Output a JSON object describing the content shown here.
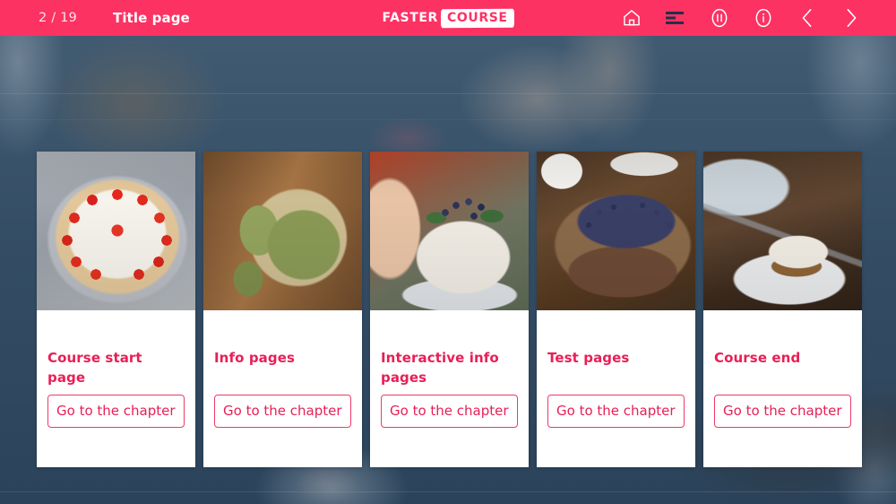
{
  "topbar": {
    "page_counter": "2 / 19",
    "page_title": "Title page",
    "logo_part1": "FASTER",
    "logo_part2": "COURSE",
    "accent_color": "#fc3263",
    "icons": [
      {
        "name": "home-icon",
        "label": "Home"
      },
      {
        "name": "menu-icon",
        "label": "Menu"
      },
      {
        "name": "pause-icon",
        "label": "Pause"
      },
      {
        "name": "info-icon",
        "label": "Info"
      },
      {
        "name": "chevron-left-icon",
        "label": "Previous"
      },
      {
        "name": "chevron-right-icon",
        "label": "Next"
      }
    ]
  },
  "cards": [
    {
      "title": "Course start page",
      "button": "Go to the chapter",
      "image": "strawberry-cake-photo"
    },
    {
      "title": "Info pages",
      "button": "Go to the chapter",
      "image": "matcha-cake-photo"
    },
    {
      "title": "Interactive info pages",
      "button": "Go to the chapter",
      "image": "blueberry-layer-cake-photo"
    },
    {
      "title": "Test pages",
      "button": "Go to the chapter",
      "image": "blueberry-tart-photo"
    },
    {
      "title": "Course end",
      "button": "Go to the chapter",
      "image": "carrot-cake-slice-photo"
    }
  ],
  "background": {
    "name": "food-on-denim-background-photo",
    "tint_color": "#2e4c68"
  }
}
